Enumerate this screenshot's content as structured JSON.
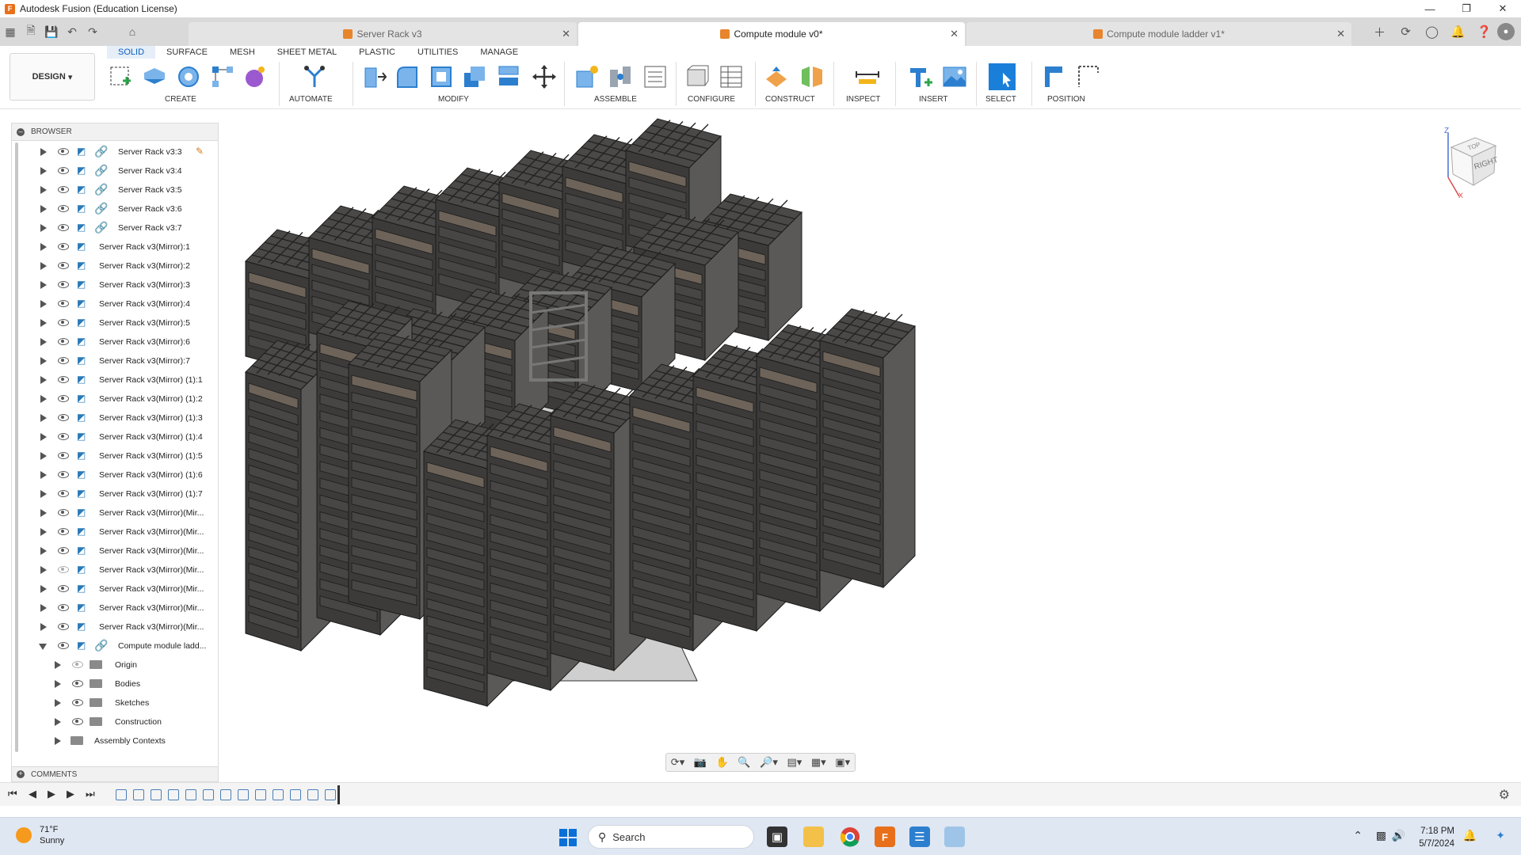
{
  "window": {
    "title": "Autodesk Fusion (Education License)",
    "app_icon": "F"
  },
  "tabs": [
    {
      "label": "Server Rack v3",
      "active": false
    },
    {
      "label": "Compute module v0*",
      "active": true
    },
    {
      "label": "Compute module ladder v1*",
      "active": false
    }
  ],
  "ribbon": {
    "workspace_button": "DESIGN",
    "tabs": [
      "SOLID",
      "SURFACE",
      "MESH",
      "SHEET METAL",
      "PLASTIC",
      "UTILITIES",
      "MANAGE"
    ],
    "active_tab": "SOLID",
    "groups": [
      "CREATE",
      "AUTOMATE",
      "MODIFY",
      "ASSEMBLE",
      "CONFIGURE",
      "CONSTRUCT",
      "INSPECT",
      "INSERT",
      "SELECT",
      "POSITION"
    ]
  },
  "browser": {
    "title": "BROWSER",
    "items": [
      {
        "label": "Server Rack v3:3",
        "linked": true,
        "edit": true
      },
      {
        "label": "Server Rack v3:4",
        "linked": true
      },
      {
        "label": "Server Rack v3:5",
        "linked": true
      },
      {
        "label": "Server Rack v3:6",
        "linked": true
      },
      {
        "label": "Server Rack v3:7",
        "linked": true
      },
      {
        "label": "Server Rack v3(Mirror):1"
      },
      {
        "label": "Server Rack v3(Mirror):2"
      },
      {
        "label": "Server Rack v3(Mirror):3"
      },
      {
        "label": "Server Rack v3(Mirror):4"
      },
      {
        "label": "Server Rack v3(Mirror):5"
      },
      {
        "label": "Server Rack v3(Mirror):6"
      },
      {
        "label": "Server Rack v3(Mirror):7"
      },
      {
        "label": "Server Rack v3(Mirror) (1):1"
      },
      {
        "label": "Server Rack v3(Mirror) (1):2"
      },
      {
        "label": "Server Rack v3(Mirror) (1):3"
      },
      {
        "label": "Server Rack v3(Mirror) (1):4"
      },
      {
        "label": "Server Rack v3(Mirror) (1):5"
      },
      {
        "label": "Server Rack v3(Mirror) (1):6"
      },
      {
        "label": "Server Rack v3(Mirror) (1):7"
      },
      {
        "label": "Server Rack v3(Mirror)(Mir..."
      },
      {
        "label": "Server Rack v3(Mirror)(Mir..."
      },
      {
        "label": "Server Rack v3(Mirror)(Mir..."
      },
      {
        "label": "Server Rack v3(Mirror)(Mir...",
        "hidden": true
      },
      {
        "label": "Server Rack v3(Mirror)(Mir..."
      },
      {
        "label": "Server Rack v3(Mirror)(Mir..."
      },
      {
        "label": "Server Rack v3(Mirror)(Mir..."
      },
      {
        "label": "Compute module ladd...",
        "linked": true,
        "open": true
      }
    ],
    "sub_items": [
      "Origin",
      "Bodies",
      "Sketches",
      "Construction"
    ],
    "assembly_contexts": "Assembly Contexts"
  },
  "comments": {
    "title": "COMMENTS"
  },
  "viewcube": {
    "face_right": "RIGHT",
    "face_top": "TOP",
    "axis_z": "Z",
    "axis_x": "X"
  },
  "taskbar": {
    "weather_temp": "71°F",
    "weather_desc": "Sunny",
    "search_placeholder": "Search",
    "time": "7:18 PM",
    "date": "5/7/2024"
  },
  "colors": {
    "accent": "#0a5fbf",
    "fusion_orange": "#e8701a",
    "rack_dark": "#3c3b3a",
    "rack_shelf": "#6d6359"
  }
}
